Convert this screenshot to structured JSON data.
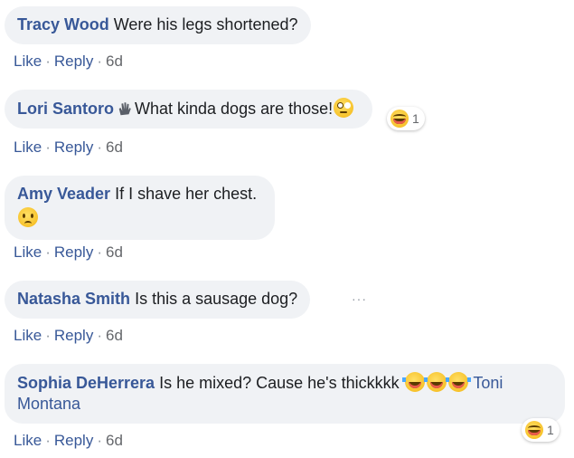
{
  "actions": {
    "like": "Like",
    "reply": "Reply",
    "sep": "·"
  },
  "comments": [
    {
      "author": "Tracy Wood",
      "text": "Were his legs shortened?",
      "time": "6d"
    },
    {
      "author": "Lori Santoro",
      "text": "What kinda dogs are those!",
      "time": "6d",
      "reaction_count": "1"
    },
    {
      "author": "Amy Veader",
      "text": "If I shave her chest.",
      "time": "6d"
    },
    {
      "author": "Natasha Smith",
      "text": "Is this a sausage dog?",
      "time": "6d",
      "more": "···"
    },
    {
      "author": "Sophia DeHerrera",
      "text": "Is he mixed? Cause he's thickkkk",
      "tag_line1": "Toni",
      "tag_line2": "Montana",
      "time": "6d",
      "reaction_count": "1"
    }
  ],
  "colors": {
    "author": "#385898",
    "bubble": "#f0f2f5",
    "meta": "#65676b"
  }
}
